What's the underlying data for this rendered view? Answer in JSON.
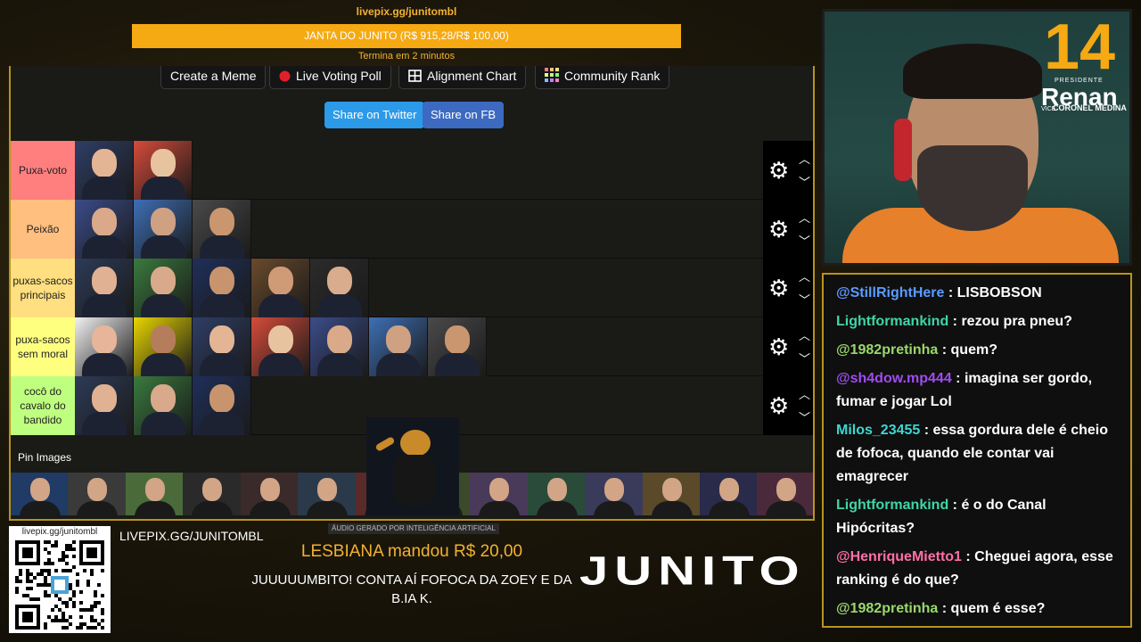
{
  "goal": {
    "url": "livepix.gg/junitombl",
    "title": "JANTA DO JUNITO (R$ 915,28/R$ 100,00)",
    "time_left": "Termina em 2 minutos"
  },
  "toolbar": {
    "meme": "Create a Meme",
    "poll": "Live Voting Poll",
    "alignment": "Alignment Chart",
    "community": "Community Rank",
    "share_twitter": "Share on Twitter",
    "share_fb": "Share on FB"
  },
  "tiers": [
    {
      "label": "Puxa-voto",
      "color": "#ff7f7f",
      "items": 2
    },
    {
      "label": "Peixão",
      "color": "#ffbf7f",
      "items": 3
    },
    {
      "label": "puxas-sacos\nprincipais",
      "color": "#ffdf7f",
      "items": 5
    },
    {
      "label": "puxa-sacos\nsem moral",
      "color": "#ffff7f",
      "items": 7
    },
    {
      "label": "cocô do\ncavalo do\nbandido",
      "color": "#bfff7f",
      "items": 3
    }
  ],
  "tier_controls": {
    "gear": "gear-icon",
    "up": "chevron-up-icon",
    "down": "chevron-down-icon"
  },
  "pin": {
    "title": "Pin Images"
  },
  "ai_note": "ÁUDIO GERADO POR INTELIGÊNCIA ARTIFICIAL",
  "qr": {
    "url": "livepix.gg/junitombl"
  },
  "livepix_url": "LIVEPIX.GG/JUNITOMBL",
  "donation": {
    "donor": "LESBIANA",
    "verb": "mandou",
    "amount": "R$ 20,00",
    "message": "JUUUUUMBITO! CONTA AÍ FOFOCA DA ZOEY E DA B.IA K."
  },
  "brand": "JUNITO",
  "cam_logo": {
    "number": "14",
    "presidente": "PRESIDENTE",
    "name": "Renan",
    "vice": "VICE",
    "coronel": "CORONEL MEDINA"
  },
  "chat": [
    {
      "user": "@StillRightHere",
      "color": "#5b9bff",
      "text": "LISBOBSON"
    },
    {
      "user": "Lightformankind",
      "color": "#3fd6a8",
      "text": "rezou pra pneu?"
    },
    {
      "user": "@1982pretinha",
      "color": "#9ad86a",
      "text": "quem?"
    },
    {
      "user": "@sh4dow.mp444",
      "color": "#a14cf0",
      "text": "imagina ser gordo, fumar e jogar Lol"
    },
    {
      "user": "Milos_23455",
      "color": "#3fd6d0",
      "text": "essa gordura dele é cheio de fofoca, quando ele contar vai emagrecer"
    },
    {
      "user": "Lightformankind",
      "color": "#3fd6a8",
      "text": "é o do Canal Hipócritas?"
    },
    {
      "user": "@HenriqueMietto1",
      "color": "#ff6fa8",
      "text": "Cheguei agora, esse ranking é do que?"
    },
    {
      "user": "@1982pretinha",
      "color": "#9ad86a",
      "text": "quem é esse?"
    }
  ]
}
